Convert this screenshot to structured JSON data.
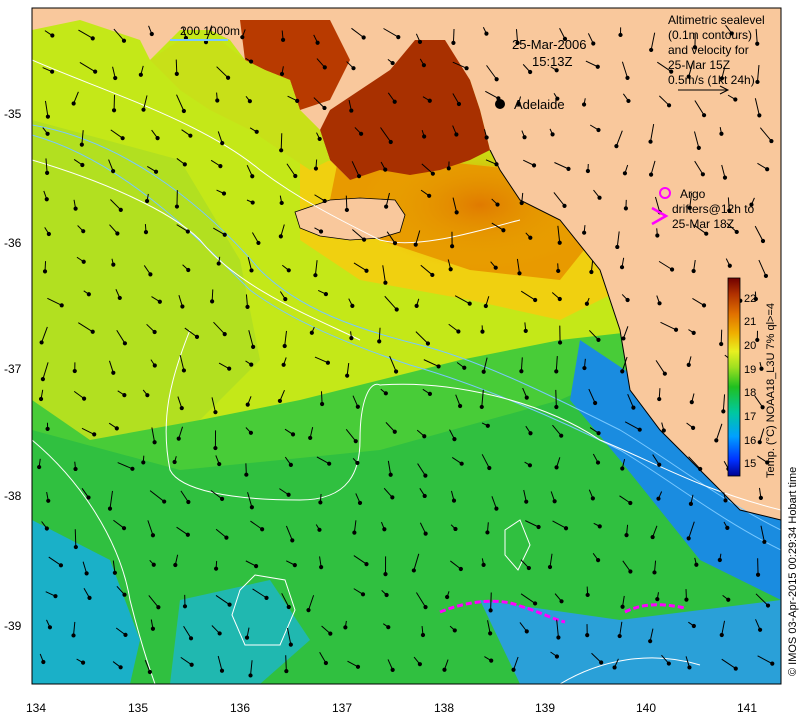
{
  "map": {
    "date": "25-Mar-2006",
    "time": "15:13Z",
    "city": "Adelaide",
    "scale_label": "200  1000m",
    "legend_lines": [
      "Altimetric sealevel",
      "(0.1m contours)",
      "and velocity for",
      "25-Mar 15Z",
      "0.5m/s (1kt 24h)"
    ],
    "argo_label": "Argo",
    "drifters_lines": [
      "drifters@12h to",
      "25-Mar 18Z"
    ],
    "colorbar_label": "Temp. (°C) NOAA18_L3U 7% ql>=4",
    "credit": "© IMOS 03-Apr-2015 00:29:34 Hobart time",
    "lon_ticks": [
      "134",
      "135",
      "136",
      "137",
      "138",
      "139",
      "140",
      "141"
    ],
    "lat_ticks": [
      "-35",
      "-36",
      "-37",
      "-38",
      "-39"
    ],
    "colorbar_ticks": [
      "22",
      "21",
      "20",
      "19",
      "18",
      "17",
      "16",
      "15"
    ],
    "colorbar_range": [
      14.5,
      22.5
    ],
    "lon_range": [
      134,
      141.33
    ],
    "lat_range": [
      -39.55,
      -34.3
    ]
  },
  "colors": {
    "land": "#f9c89c",
    "ocean_mid": "#b9e814",
    "ocean_cool": "#32c832",
    "ocean_cold": "#00a0f0",
    "warm": "#e08800",
    "hot": "#a03000",
    "argo": "#ff00ff",
    "contour": "#ffffff",
    "isobath": "#78c8ff"
  }
}
